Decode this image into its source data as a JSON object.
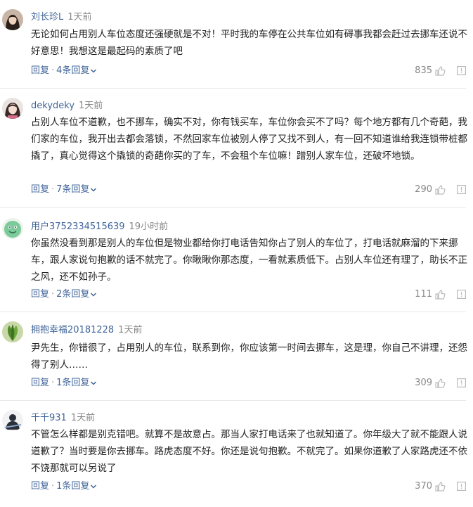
{
  "comments": [
    {
      "username": "刘长珍L",
      "time": "1天前",
      "text": "无论如何占用别人车位态度还强硬就是不对！平时我的车停在公共车位如有碍事我都会赶过去挪车还说不好意思！我想这是最起码的素质了吧",
      "reply_label": "回复",
      "replies_label": "4条回复",
      "likes": "835",
      "avatar": "avatar-woman-dark-hair"
    },
    {
      "username": "dekydeky",
      "time": "1天前",
      "text": "占别人车位不道歉，也不挪车，确实不对，你有钱买车，车位你会买不了吗？每个地方都有几个奇葩，我们家的车位，我开出去都会落锁，不然回家车位被别人停了又找不到人，有一回不知道谁给我连锁带桩都撬了，真心觉得这个撬锁的奇葩你买的了车，不会租个车位嘛！蹭别人家车位，还破坏地锁。",
      "reply_label": "回复",
      "replies_label": "7条回复",
      "likes": "290",
      "avatar": "avatar-girl-portrait"
    },
    {
      "username": "用户3752334515639",
      "time": "19小时前",
      "text": "你虽然没看到那是别人的车位但是物业都给你打电话告知你占了别人的车位了，打电话就麻溜的下来挪车，跟人家说句抱歉的话不就完了。你瞅瞅你那态度，一看就素质低下。占别人车位还有理了，助长不正之风，还不如孙子。",
      "reply_label": "回复",
      "replies_label": "2条回复",
      "likes": "111",
      "avatar": "avatar-default-green"
    },
    {
      "username": "拥抱幸福20181228",
      "time": "1天前",
      "text": "尹先生，你错很了，占用别人的车位，联系到你，你应该第一时间去挪车，这是理，你自己不讲理，还怨得了别人……",
      "reply_label": "回复",
      "replies_label": "1条回复",
      "likes": "309",
      "avatar": "avatar-green-plant"
    },
    {
      "username": "千千931",
      "time": "1天前",
      "text": "不管怎么样都是别克错吧。就算不是故意占。那当人家打电话来了也就知道了。你年级大了就不能跟人说道歉了？当时要是你去挪车。路虎态度不好。你还是说句抱歉。不就完了。如果你道歉了人家路虎还不依不饶那就可以另说了",
      "reply_label": "回复",
      "replies_label": "1条回复",
      "likes": "370",
      "avatar": "avatar-person-silhouette"
    }
  ],
  "colors": {
    "username": "#406599",
    "meta": "#888888",
    "text": "#222222",
    "divider": "#e8e8e8"
  },
  "icons": {
    "like": "thumbs-up-icon",
    "report": "report-icon",
    "expand": "chevron-down-icon"
  }
}
